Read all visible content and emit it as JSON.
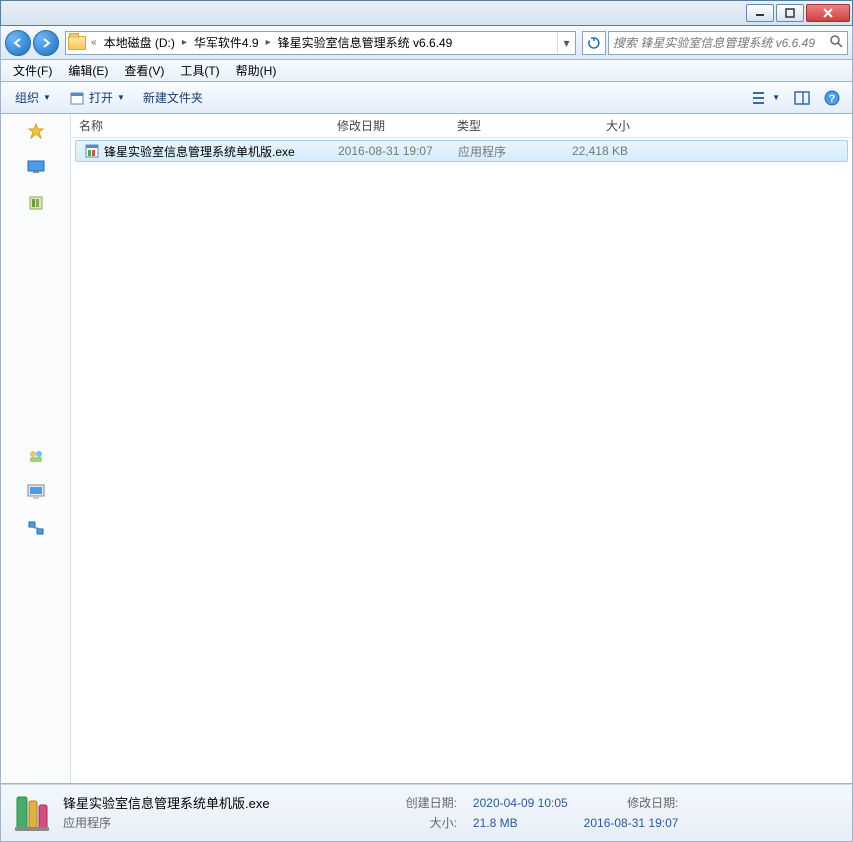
{
  "window": {
    "breadcrumbs": [
      "本地磁盘 (D:)",
      "华军软件4.9",
      "锋星实验室信息管理系统 v6.6.49"
    ],
    "search_placeholder": "搜索 锋星实验室信息管理系统 v6.6.49"
  },
  "menubar": [
    "文件(F)",
    "编辑(E)",
    "查看(V)",
    "工具(T)",
    "帮助(H)"
  ],
  "toolbar": {
    "organize": "组织",
    "open": "打开",
    "newfolder": "新建文件夹"
  },
  "columns": {
    "name": "名称",
    "date": "修改日期",
    "type": "类型",
    "size": "大小"
  },
  "files": [
    {
      "name": "锋星实验室信息管理系统单机版.exe",
      "date": "2016-08-31 19:07",
      "type": "应用程序",
      "size": "22,418 KB"
    }
  ],
  "details": {
    "name": "锋星实验室信息管理系统单机版.exe",
    "type": "应用程序",
    "mod_label": "修改日期:",
    "mod_val": "2016-08-31 19:07",
    "size_label": "大小:",
    "size_val": "21.8 MB",
    "create_label": "创建日期:",
    "create_val": "2020-04-09 10:05"
  }
}
